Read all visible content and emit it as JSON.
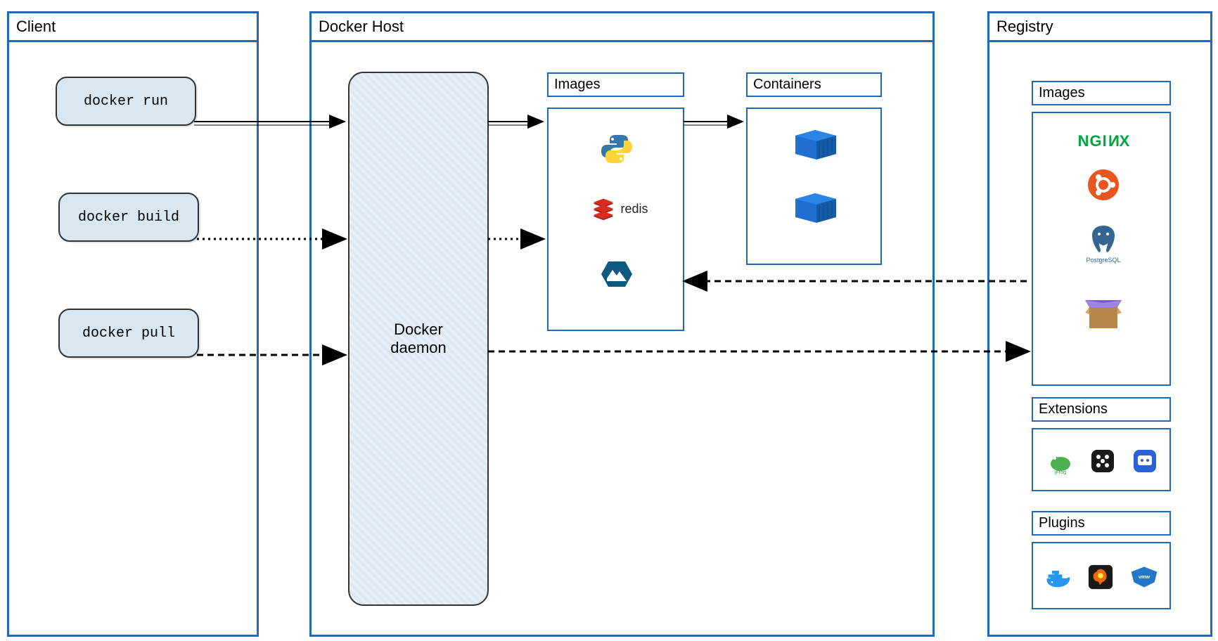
{
  "panels": {
    "client": {
      "title": "Client"
    },
    "host": {
      "title": "Docker Host"
    },
    "registry": {
      "title": "Registry"
    }
  },
  "client_commands": {
    "run": "docker run",
    "build": "docker build",
    "pull": "docker pull"
  },
  "daemon": {
    "label": "Docker\ndaemon"
  },
  "host_boxes": {
    "images": {
      "title": "Images"
    },
    "containers": {
      "title": "Containers"
    }
  },
  "registry_boxes": {
    "images": {
      "title": "Images"
    },
    "extensions": {
      "title": "Extensions"
    },
    "plugins": {
      "title": "Plugins"
    }
  },
  "host_images": {
    "python": "python",
    "redis": "redis",
    "alpine": "alpine"
  },
  "registry_images": {
    "nginx": "NGINX",
    "ubuntu": "ubuntu",
    "postgres": "PostgreSQL",
    "box": "package"
  },
  "registry_extensions": {
    "jfrog": "JFrog",
    "portainer": "portainer",
    "app": "app"
  },
  "registry_plugins": {
    "docker": "docker",
    "grafana": "grafana",
    "vmware": "vmware"
  }
}
